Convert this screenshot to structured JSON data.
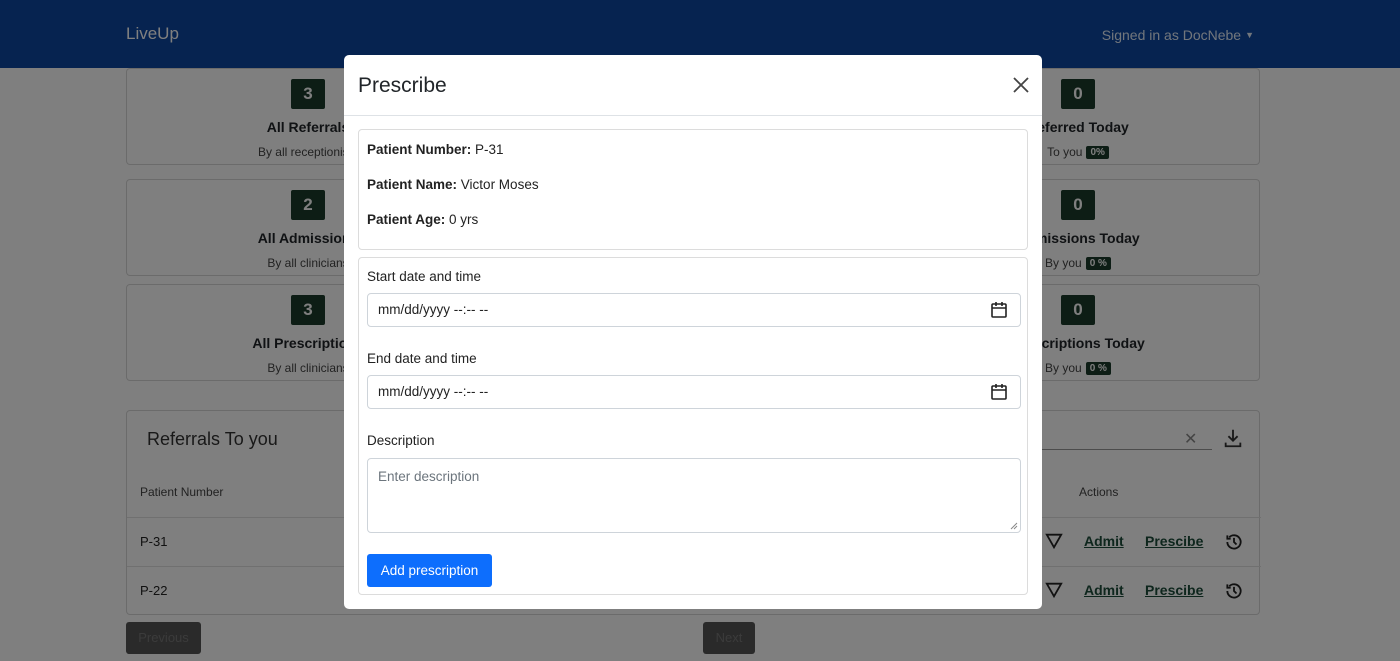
{
  "app": {
    "brand": "LiveUp",
    "signed_in": "Signed in as DocNebe"
  },
  "stats": [
    {
      "left_value": "3",
      "left_title": "All Referrals",
      "left_sub": "By all receptionists",
      "right_value": "0",
      "right_title": "Referred Today",
      "right_sub": "To you",
      "right_pct": "0%"
    },
    {
      "left_value": "2",
      "left_title": "All Admissions",
      "left_sub": "By all clinicians",
      "right_value": "0",
      "right_title": "Admissions Today",
      "right_sub": "By you",
      "right_pct": "0 %"
    },
    {
      "left_value": "3",
      "left_title": "All Prescriptions",
      "left_sub": "By all clinicians",
      "right_value": "0",
      "right_title": "Prescriptions Today",
      "right_sub": "By you",
      "right_pct": "0 %"
    }
  ],
  "referrals": {
    "title": "Referrals To you",
    "columns": {
      "patient_number": "Patient Number",
      "actions": "Actions"
    },
    "rows": [
      {
        "patient_number": "P-31",
        "admit": "Admit",
        "prescribe": "Prescibe"
      },
      {
        "patient_number": "P-22",
        "admit": "Admit",
        "prescribe": "Prescibe"
      }
    ],
    "previous_label": "Previous",
    "next_label": "Next"
  },
  "modal": {
    "title": "Prescribe",
    "patient_number_label": "Patient Number:",
    "patient_number": "P-31",
    "patient_name_label": "Patient Name:",
    "patient_name": "Victor Moses",
    "patient_age_label": "Patient Age:",
    "patient_age": "0 yrs",
    "start_label": "Start date and time",
    "start_value": "mm/dd/yyyy --:-- --",
    "end_label": "End date and time",
    "end_value": "mm/dd/yyyy --:-- --",
    "description_label": "Description",
    "description_placeholder": "Enter description",
    "submit_label": "Add prescription"
  },
  "colors": {
    "navbar": "#0d47a1",
    "primary": "#0d6efd",
    "badge": "#1b3b2a"
  }
}
